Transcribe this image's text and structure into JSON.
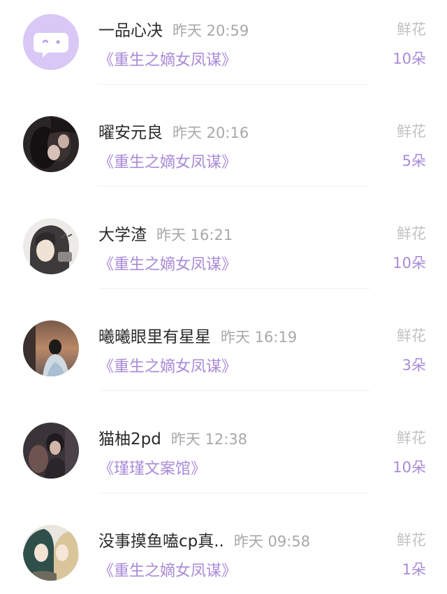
{
  "rows": [
    {
      "name": "一品心决",
      "time": "昨天 20:59",
      "book": "《重生之嫡女凤谋》",
      "gift_label": "鲜花",
      "gift_count": "10朵",
      "avatar": "default-chat-avatar-icon"
    },
    {
      "name": "曜安元良",
      "time": "昨天 20:16",
      "book": "《重生之嫡女凤谋》",
      "gift_label": "鲜花",
      "gift_count": "5朵",
      "avatar": "dark-couple-avatar"
    },
    {
      "name": "大学渣",
      "time": "昨天 16:21",
      "book": "《重生之嫡女凤谋》",
      "gift_label": "鲜花",
      "gift_count": "10朵",
      "avatar": "anime-girl-hood-avatar"
    },
    {
      "name": "曦曦眼里有星星",
      "time": "昨天 16:19",
      "book": "《重生之嫡女凤谋》",
      "gift_label": "鲜花",
      "gift_count": "3朵",
      "avatar": "girl-sunset-avatar"
    },
    {
      "name": "猫柚2pd",
      "time": "昨天 12:38",
      "book": "《瑾瑾文案馆》",
      "gift_label": "鲜花",
      "gift_count": "10朵",
      "avatar": "dark-photo-avatar"
    },
    {
      "name": "没事摸鱼嗑cp真..",
      "time": "昨天 09:58",
      "book": "《重生之嫡女凤谋》",
      "gift_label": "鲜花",
      "gift_count": "1朵",
      "avatar": "anime-couple-avatar"
    }
  ],
  "colors": {
    "accent": "#a98ad8",
    "name": "#2b2b2b",
    "muted": "#a8a8a8",
    "default_avatar_bg": "#d9c8f5"
  }
}
